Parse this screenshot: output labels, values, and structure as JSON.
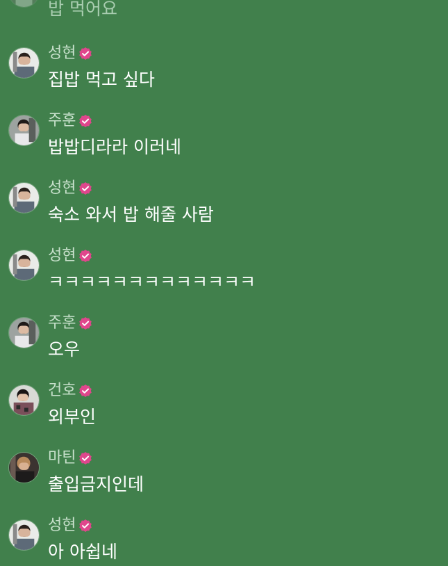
{
  "colors": {
    "background": "#41804c",
    "name_text": "#c7e0cb",
    "message_text": "#ffffff",
    "badge": "#e0468c"
  },
  "icons": {
    "verified": "verified-badge-icon",
    "avatar": "user-avatar"
  },
  "messages": [
    {
      "name": "",
      "text": "밥 먹어요"
    },
    {
      "name": "성현",
      "text": "집밥 먹고 싶다"
    },
    {
      "name": "주훈",
      "text": "밥밥디라라 이러네"
    },
    {
      "name": "성현",
      "text": "숙소 와서 밥 해줄 사람"
    },
    {
      "name": "성현",
      "text": "ㅋㅋㅋㅋㅋㅋㅋㅋㅋㅋㅋㅋㅋ"
    },
    {
      "name": "주훈",
      "text": "오우"
    },
    {
      "name": "건호",
      "text": "외부인"
    },
    {
      "name": "마틴",
      "text": "출입금지인데"
    },
    {
      "name": "성현",
      "text": "아 아쉽네"
    }
  ]
}
